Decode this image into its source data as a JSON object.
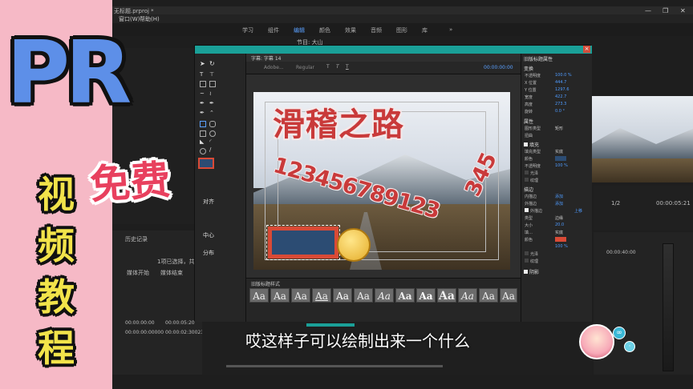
{
  "app": {
    "title": "无标题.prproj *",
    "menu": [
      "窗口(W)",
      "帮助(H)"
    ],
    "workspaces": [
      "学习",
      "组件",
      "编辑",
      "颜色",
      "效果",
      "音频",
      "图形",
      "库"
    ],
    "active_workspace": "编辑",
    "window_controls": [
      "—",
      "❐",
      "✕"
    ],
    "source_label": "节目: 大山"
  },
  "overlay": {
    "brand": "PR",
    "badge": "免费",
    "vertical": [
      "视",
      "频",
      "教",
      "程"
    ]
  },
  "dialog": {
    "title_tab": "字幕: 字幕 14",
    "font_placeholder": "Adobe...",
    "font_style": "Regular",
    "timecode": "00:00:00:00",
    "title_text": "滑稽之路",
    "numbers_text": "123456789123",
    "numbers_tail": "345",
    "styles_label": "旧版标题样式",
    "style_sample": "Aa",
    "tool_labels": [
      "对齐",
      "中心",
      "分布"
    ]
  },
  "properties": {
    "header": "旧版标题属性",
    "transform_label": "变换",
    "rows": [
      {
        "label": "不透明度",
        "value": "100.0 %"
      },
      {
        "label": "X 位置",
        "value": "444.7"
      },
      {
        "label": "Y 位置",
        "value": "1297.6"
      },
      {
        "label": "宽度",
        "value": "422.7"
      },
      {
        "label": "高度",
        "value": "273.3"
      },
      {
        "label": "旋转",
        "value": "0.0 °"
      }
    ],
    "attributes_label": "属性",
    "shape_type_label": "图形类型",
    "shape_type_value": "矩形",
    "distort_label": "扭曲",
    "fill_label": "填充",
    "fill_type_label": "填充类型",
    "fill_type_value": "实底",
    "color_label": "颜色",
    "opacity_label": "不透明度",
    "opacity_value": "100 %",
    "sheen_label": "光泽",
    "texture_label": "纹理",
    "stroke_label": "描边",
    "inner_stroke": "内描边",
    "outer_stroke": "外描边",
    "add_label": "添加",
    "outer_stroke_item": "外描边",
    "up_label": "上移",
    "type_label": "类型",
    "type_value": "边缘",
    "size_label": "大小",
    "size_value": "20.0",
    "fill2_label": "填…",
    "fill2_value": "实底",
    "opacity2_value": "100 %",
    "sheen2_label": "光泽",
    "texture2_label": "纹理",
    "shadow_label": "阴影",
    "fill_color": "#2c4c73",
    "stroke_color": "#d94a36"
  },
  "left_panel": {
    "history_label": "历史记录",
    "selection_text": "1项已选择，共 1",
    "col_start": "媒体开始",
    "col_end": "媒体结束",
    "rows": [
      {
        "start": "00:00:00:00",
        "end": "00:00:05:20"
      },
      {
        "start": "00:00:00:00000",
        "end": "00:00:02:30023"
      }
    ]
  },
  "monitor": {
    "zoom": "1/2",
    "timecode_end": "00:00:05:21",
    "ruler_time": "00:00:40:00"
  },
  "subtitle": "哎这样子可以绘制出来一个什么"
}
